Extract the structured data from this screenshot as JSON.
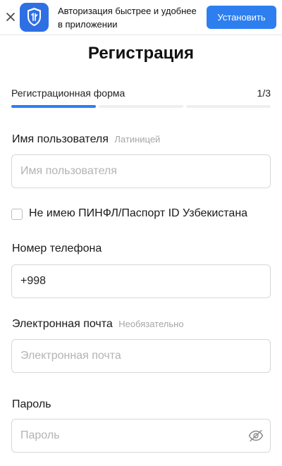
{
  "banner": {
    "text": "Авторизация быстрее и удобнее в приложении",
    "install_label": "Установить",
    "close_icon": "close-icon",
    "logo_icon": "shield-logo-icon",
    "accent_color": "#2d7ff0"
  },
  "page": {
    "title": "Регистрация"
  },
  "steps": {
    "label": "Регистрационная форма",
    "count": "1/3",
    "current": 1,
    "total": 3
  },
  "form": {
    "username": {
      "label": "Имя пользователя",
      "hint": "Латиницей",
      "placeholder": "Имя пользователя",
      "value": ""
    },
    "no_pinfl": {
      "label": "Не имею ПИНФЛ/Паспорт ID Узбекистана",
      "checked": false
    },
    "phone": {
      "label": "Номер телефона",
      "value": "+998"
    },
    "email": {
      "label": "Электронная почта",
      "hint": "Необязательно",
      "placeholder": "Электронная почта",
      "value": ""
    },
    "password": {
      "label": "Пароль",
      "placeholder": "Пароль",
      "value": "",
      "toggle_icon": "eye-slash-icon"
    }
  }
}
